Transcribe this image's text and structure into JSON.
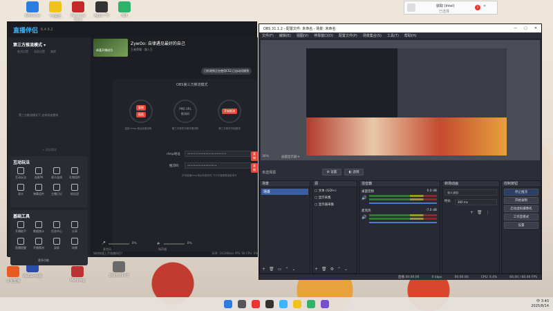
{
  "desktop": {
    "icons": [
      {
        "label": "WeGame",
        "color": "#2a7de1"
      },
      {
        "label": "YY语音",
        "color": "#f2c21c"
      },
      {
        "label": "Personal Deal",
        "color": "#c62828"
      },
      {
        "label": "Apple TV",
        "color": "#333"
      },
      {
        "label": "NDI",
        "color": "#2fb36b"
      },
      {
        "label": "WeGame版",
        "color": "#2a4ea8"
      },
      {
        "label": "2025.09.07",
        "color": "#6a6a6a"
      },
      {
        "label": "Mahjong",
        "color": "#b33"
      },
      {
        "label": "斗鱼直播",
        "color": "#e85b1e"
      }
    ]
  },
  "notification": {
    "title": "获取 (Intel)",
    "subtitle": "已选择",
    "badge": "1"
  },
  "live_assistant": {
    "app_title": "直播伴侣",
    "version": "6.4.9.2",
    "mode_label": "第三方推流模式",
    "mode_tabs": [
      "推流设置",
      "画面设置",
      "美颜"
    ],
    "empty_text": "第三方推流模式下 支持添加素材",
    "add_source": "+ 添加素材",
    "interaction_title": "互动玩法",
    "interaction_tools": [
      "互动玩法",
      "连麦PK",
      "观众连线",
      "礼物组件",
      "观众",
      "弹幕组件",
      "主播日记",
      "粉丝团",
      "投票",
      "弹幕提醒"
    ],
    "basic_title": "基础工具",
    "basic_tools": [
      "开播助手",
      "数据统计",
      "任务中心",
      "分享",
      "直播提醒",
      "开播素材",
      "录屏",
      "场景",
      "虚拟主播",
      "效果"
    ],
    "more": "更多功能",
    "streamer_name": "ZywOo: 自律遇见最好的自己",
    "category": "王者荣耀 · 路人王",
    "banner_text": "恭喜开播成功",
    "toast": "已检测到正在使用CS2,已自动切换到",
    "obs_mode_title": "OBS第三方推流模式",
    "steps": [
      {
        "label": "复制",
        "caption": "复制 rtmp 地址及推流码"
      },
      {
        "label": "粘贴",
        "caption": "第三方软件中填写推流码"
      },
      {
        "label": "开始推流",
        "caption": "第三方软件开始推流"
      }
    ],
    "step_sub": "PMS URL",
    "step_sub2": "推流码",
    "rtmp_label": "rtmp地址",
    "rtmp_value": "••••••••••••••••••••••••",
    "key_label": "推流码",
    "key_value": "••••••••••••••••••",
    "copy_btn": "复制",
    "hint": "本场直播rtmp地址有更新时,下次开播需要重新填写",
    "mic_label": "麦克风",
    "mic_pct": "0%",
    "spk_label": "扬声器",
    "spk_pct": "0%",
    "status": "如何快速上手直播伴侣?",
    "bitrate": "码率: 14339kb/s",
    "fps": "FPS: 60",
    "cpu": "CPU: 0%"
  },
  "obs": {
    "title": "OBS 31.1.2 - 配置文件: 未命名 - 场景: 未命名",
    "menu": [
      "文件(F)",
      "编辑(E)",
      "视图(V)",
      "停靠窗口(D)",
      "配置文件(P)",
      "场景集合(S)",
      "工具(T)",
      "帮助(H)"
    ],
    "zoom": "36%",
    "canvas_label": "画面显示器",
    "no_source": "未选择源",
    "props_btn": "设置",
    "filters_btn": "滤镜",
    "scenes_title": "场景",
    "scenes": [
      "场景"
    ],
    "sources_title": "源",
    "sources": [
      "文本 (GDI+)",
      "显示采集",
      "显示器采集"
    ],
    "mixer_title": "混音器",
    "mixer": [
      {
        "name": "桌面音频",
        "db": "0.0 dB"
      },
      {
        "name": "麦克风",
        "db": "-7.0 dB"
      }
    ],
    "transitions_title": "转场动画",
    "transition": "淡入淡出",
    "duration_label": "时长",
    "duration": "300 ms",
    "controls_title": "控制按钮",
    "controls": [
      "停止推流",
      "开始录制",
      "启动虚拟摄像机",
      "工作室模式",
      "设置"
    ],
    "status": [
      "直播 00:00:00",
      "0 kbps",
      "00:00:00",
      "CPU: 0.4%",
      "60.00 / 60.00 FPS"
    ]
  },
  "taskbar": {
    "time": "3:40",
    "date": "2025/8/14",
    "lang": "中"
  }
}
